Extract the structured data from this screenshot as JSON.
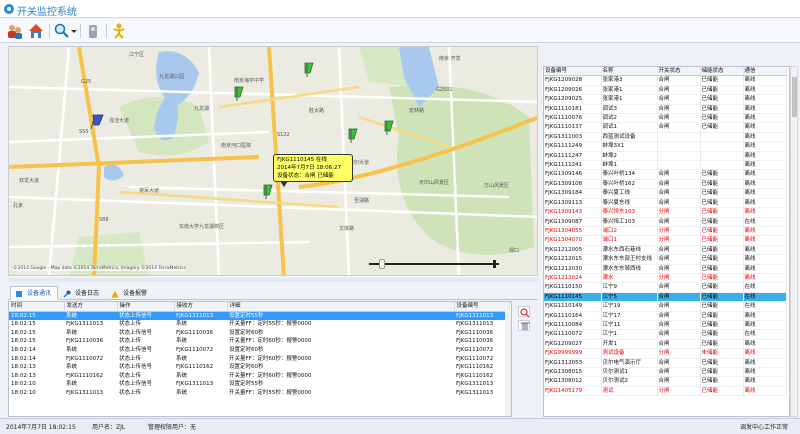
{
  "app": {
    "title": "开关监控系统"
  },
  "toolbar": {
    "icons": [
      "users-icon",
      "home-icon",
      "search-icon",
      "chevron-down-icon",
      "gear-icon",
      "exit-icon"
    ]
  },
  "map": {
    "labels": [
      "江宁区",
      "九龙湖",
      "浅洼大道",
      "九龙湖公园",
      "南京海宇中学",
      "东南大学九龙湖校区",
      "南京河口医院",
      "吉印大道",
      "天印山风景区",
      "方山风景区",
      "禄口",
      "南京·开发",
      "双龙大道",
      "胜太路",
      "将军大道",
      "圣湖路",
      "宏林路",
      "S55",
      "G25",
      "S88",
      "G2501",
      "S122",
      "文体路",
      "孔家"
    ],
    "callout": {
      "line1": "FJKG1110145 在线",
      "line2": "2014年7月7日 18:06:27",
      "line3": "设备状态：合闸 已储能"
    },
    "copyright": "©2014 Google - Map data ©2014 TerraMetrics, Imagery ©2014 TerraMetrics"
  },
  "tabs": [
    {
      "label": "设备通讯"
    },
    {
      "label": "设备日志"
    },
    {
      "label": "设备报警"
    }
  ],
  "log": {
    "columns": [
      "时间",
      "发送方",
      "操作",
      "接收方",
      "详细",
      "设备编号"
    ],
    "rows": [
      [
        "18:02:15",
        "系统",
        "状态上传信号",
        "FJKG1311013",
        "设置定时55秒",
        "FJKG1311013"
      ],
      [
        "18:02:15",
        "FJKG1311013",
        "状态上传",
        "系统",
        "开关量FF：定时55秒：报警0000",
        "FJKG1311013"
      ],
      [
        "18:02:15",
        "系统",
        "状态上传信号",
        "FJKG1110036",
        "设置定时60秒",
        "FJKG1110036"
      ],
      [
        "18:02:15",
        "FJKG1110036",
        "状态上传",
        "系统",
        "开关量FF：定时60秒：报警0000",
        "FJKG1110036"
      ],
      [
        "18:02:14",
        "系统",
        "状态上传信号",
        "FJKG1110072",
        "设置定时60秒",
        "FJKG1110072"
      ],
      [
        "18:02:14",
        "FJKG1110072",
        "状态上传",
        "系统",
        "开关量FF：定时60秒：报警0000",
        "FJKG1110072"
      ],
      [
        "18:02:13",
        "系统",
        "状态上传信号",
        "FJKG1110162",
        "设置定时60秒",
        "FJKG1110162"
      ],
      [
        "18:02:13",
        "FJKG1110162",
        "状态上传",
        "系统",
        "开关量FF：定时60秒：报警0000",
        "FJKG1110162"
      ],
      [
        "18:02:10",
        "系统",
        "状态上传信号",
        "FJKG1311013",
        "设置定时55秒",
        "FJKG1311013"
      ],
      [
        "18:02:10",
        "FJKG1311013",
        "状态上传",
        "系统",
        "开关量FF：定时55秒：报警0000",
        "FJKG1311013"
      ]
    ]
  },
  "devices": {
    "columns": [
      "设备编号",
      "名称",
      "开关状态",
      "储能状态",
      "通信"
    ],
    "rows": [
      [
        "FJKG1209028",
        "张家港3",
        "合闸",
        "已储能",
        "离线",
        ""
      ],
      [
        "FJKG1209026",
        "张家港1",
        "合闸",
        "已储能",
        "离线",
        ""
      ],
      [
        "FJKG1209025",
        "张家港1",
        "合闸",
        "已储能",
        "离线",
        ""
      ],
      [
        "FJKG1110181",
        "调试3",
        "合闸",
        "已储能",
        "离线",
        ""
      ],
      [
        "FJKG1110076",
        "调试2",
        "合闸",
        "已储能",
        "离线",
        ""
      ],
      [
        "FJKG1110137",
        "调试1",
        "合闸",
        "已储能",
        "离线",
        ""
      ],
      [
        "FJKG1311003",
        "西蓝测试设备",
        "",
        "",
        "离线",
        ""
      ],
      [
        "FJKG1111249",
        "蚌埠3X1",
        "",
        "",
        "离线",
        ""
      ],
      [
        "FJKG1111247",
        "蚌埠2",
        "",
        "",
        "离线",
        ""
      ],
      [
        "FJKG1111241",
        "蚌埠1",
        "",
        "",
        "离线",
        ""
      ],
      [
        "FJKG1309146",
        "泰兴叶桥134",
        "合闸",
        "已储能",
        "离线",
        ""
      ],
      [
        "FJKG1309108",
        "泰兴叶桥162",
        "合闸",
        "已储能",
        "离线",
        ""
      ],
      [
        "FJKG1309184",
        "泰兴夏工线",
        "合闸",
        "已储能",
        "离线",
        ""
      ],
      [
        "FJKG1309113",
        "泰兴夏东线",
        "合闸",
        "已储能",
        "离线",
        ""
      ],
      [
        "FJKG1309143",
        "泰兴恒东103",
        "分闸",
        "已储能",
        "离线",
        "red"
      ],
      [
        "FJKG1309087",
        "泰兴恒工103",
        "合闸",
        "已储能",
        "在线",
        ""
      ],
      [
        "FJKG1304055",
        "浦口2",
        "分闸",
        "已储能",
        "离线",
        "red"
      ],
      [
        "FJKG1304070",
        "浦口1",
        "分闸",
        "已储能",
        "离线",
        "red"
      ],
      [
        "FJKG1212005",
        "溧水东西石巷线",
        "合闸",
        "已储能",
        "离线",
        ""
      ],
      [
        "FJKG1212015",
        "溧水东东部王村支线",
        "合闸",
        "已储能",
        "离线",
        ""
      ],
      [
        "FJKG1212030",
        "溧水东东琴西线",
        "合闸",
        "已储能",
        "离线",
        ""
      ],
      [
        "FJKG1212024",
        "溧水",
        "分闸",
        "已储能",
        "离线",
        "red"
      ],
      [
        "FJKG1110150",
        "江宁9",
        "合闸",
        "已储能",
        "在线",
        ""
      ],
      [
        "FJKG1110145",
        "江宁5",
        "合闸",
        "已储能",
        "在线",
        "sel"
      ],
      [
        "FJKG1110149",
        "江宁19",
        "合闸",
        "已储能",
        "在线",
        ""
      ],
      [
        "FJKG1110164",
        "江宁17",
        "合闸",
        "已储能",
        "离线",
        ""
      ],
      [
        "FJKG1110084",
        "江宁11",
        "合闸",
        "已储能",
        "离线",
        ""
      ],
      [
        "FJKG1110072",
        "江宁1",
        "合闸",
        "已储能",
        "在线",
        ""
      ],
      [
        "FJKG1209027",
        "开发1",
        "合闸",
        "已储能",
        "离线",
        ""
      ],
      [
        "FJKG9999999",
        "测试设备",
        "分闸",
        "未储能",
        "离线",
        "red"
      ],
      [
        "FJKG1312053",
        "贝尔电气演示厅",
        "合闸",
        "已储能",
        "离线",
        ""
      ],
      [
        "FJKG1308015",
        "贝尔测试1",
        "合闸",
        "已储能",
        "离线",
        ""
      ],
      [
        "FJKG1308012",
        "贝尔测试2",
        "合闸",
        "已储能",
        "离线",
        ""
      ],
      [
        "FJKG1405179",
        "测试",
        "分闸",
        "已储能",
        "离线",
        "red"
      ]
    ]
  },
  "status": {
    "datetime": "2014年7月7日 18:02:15",
    "user": "用户名：ZJL",
    "perm": "管理权限用户：无",
    "company": "调发中心工作正常"
  }
}
